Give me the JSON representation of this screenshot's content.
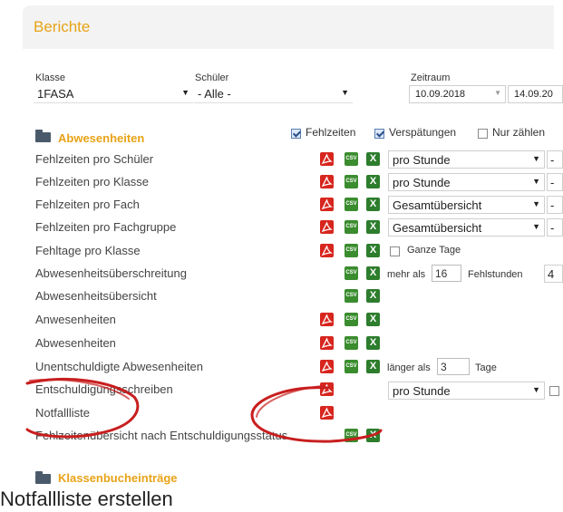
{
  "header": {
    "title": "Berichte"
  },
  "filters": {
    "klasse": {
      "label": "Klasse",
      "value": "1FASA"
    },
    "schueler": {
      "label": "Schüler",
      "value": "- Alle -"
    },
    "zeitraum": {
      "label": "Zeitraum",
      "from": "10.09.2018",
      "to": "14.09.20"
    }
  },
  "section_abwesenheiten": {
    "title": "Abwesenheiten",
    "cb_fehlzeiten": "Fehlzeiten",
    "cb_verspaetungen": "Verspätungen",
    "cb_nurzaehlen": "Nur zählen"
  },
  "rows": [
    {
      "label": "Fehlzeiten pro Schüler",
      "select": "pro Stunde"
    },
    {
      "label": "Fehlzeiten pro Klasse",
      "select": "pro Stunde"
    },
    {
      "label": "Fehlzeiten pro Fach",
      "select": "Gesamtübersicht"
    },
    {
      "label": "Fehlzeiten pro Fachgruppe",
      "select": "Gesamtübersicht"
    },
    {
      "label": "Fehltage pro Klasse",
      "option": "Ganze Tage"
    },
    {
      "label": "Abwesenheitsüberschreitung",
      "prefix": "mehr als",
      "value": "16",
      "suffix": "Fehlstunden",
      "extra": "4"
    },
    {
      "label": "Abwesenheitsübersicht"
    },
    {
      "label": "Anwesenheiten"
    },
    {
      "label": "Abwesenheiten"
    },
    {
      "label": "Unentschuldigte Abwesenheiten",
      "prefix": "länger als",
      "value": "3",
      "suffix": "Tage"
    },
    {
      "label": "Entschuldigungsschreiben",
      "select": "pro Stunde"
    },
    {
      "label": "Notfallliste"
    },
    {
      "label": "Fehlzeitenübersicht nach Entschuldigungsstatus"
    }
  ],
  "section_klassenbuch": {
    "title": "Klassenbucheinträge"
  },
  "icons": {
    "pdf": "pdf-icon",
    "csv": "CSV",
    "xls": "X"
  },
  "caption": "Notfallliste erstellen",
  "colors": {
    "accent": "#e8a317",
    "pdf": "#d7261e",
    "excel": "#2d7d2d",
    "scribble": "#c81e1e"
  }
}
